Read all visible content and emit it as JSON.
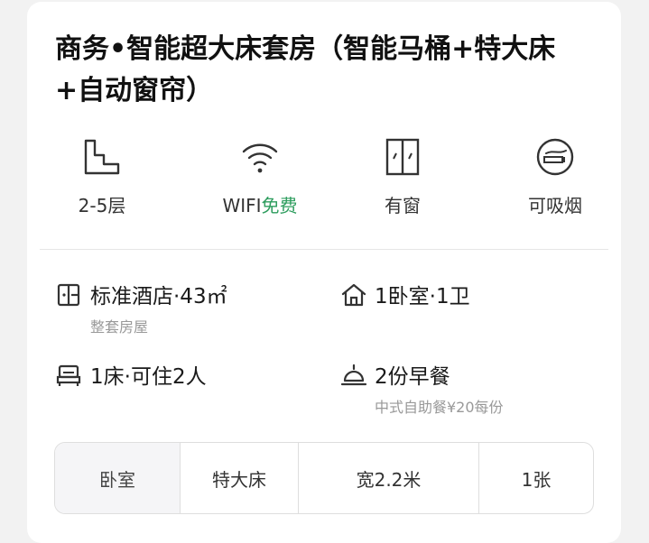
{
  "room": {
    "title": "商务•智能超大床套房（智能马桶+特大床+自动窗帘）"
  },
  "features": [
    {
      "icon": "floor-stairs-icon",
      "label": "2-5层"
    },
    {
      "icon": "wifi-icon",
      "label": "WIFI",
      "highlight": "免费"
    },
    {
      "icon": "window-icon",
      "label": "有窗"
    },
    {
      "icon": "smoking-icon",
      "label": "可吸烟"
    }
  ],
  "info": {
    "hotel_type": {
      "icon": "hotel-icon",
      "label": "标准酒店·43㎡",
      "sub": "整套房屋"
    },
    "rooms": {
      "icon": "house-icon",
      "label": "1卧室·1卫"
    },
    "occupancy": {
      "icon": "bed-icon",
      "label": "1床·可住2人"
    },
    "breakfast": {
      "icon": "service-bell-icon",
      "label": "2份早餐",
      "sub": "中式自助餐¥20每份"
    }
  },
  "bed_table": {
    "cells": [
      "卧室",
      "特大床",
      "宽2.2米",
      "1张"
    ]
  }
}
